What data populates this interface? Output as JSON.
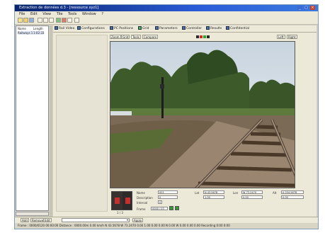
{
  "window": {
    "title": "Extraction de données d.3 - [ressource xyz1]",
    "min": "_",
    "max": "□",
    "close": "×"
  },
  "menu": [
    "File",
    "Edit",
    "View",
    "Tile",
    "Tools",
    "Window",
    "?"
  ],
  "left_panel": {
    "headers": [
      "Name",
      "Length"
    ],
    "rows": [
      [
        "Railways 1",
        "1:02:33"
      ]
    ]
  },
  "tabs": [
    "Rail Video",
    "Configurations",
    "PC Positions",
    "Grid",
    "Parameters",
    "Controller",
    "Results",
    "Confidential"
  ],
  "image_toolbar": {
    "buttons": [
      "Zoom",
      "Grid",
      "Tools",
      "Compare"
    ],
    "right_buttons": [
      "Left",
      "Right"
    ]
  },
  "thumbnail_caption": "1 / 3",
  "form": {
    "name_label": "Name",
    "name_value": "001",
    "description_label": "Description",
    "description_value": "0",
    "interval_label": "Interval",
    "interval_value": "0",
    "frame_label": "Frame",
    "frame_value": "0000 / 03",
    "col1_label": "Lat",
    "col1_value": "N 43.5678",
    "col1_sub": "1.00",
    "col2_label": "Lon",
    "col2_value": "W 73.2470",
    "col2_sub": "0.00",
    "col3_label": "Alt",
    "col3_value": "A 034.5678",
    "col3_sub": "0.00"
  },
  "bottom_bar": {
    "buttons": [
      "Add",
      "Remove",
      "Edit"
    ],
    "select_value": "",
    "right_button": "Apply"
  },
  "status_text": "Frame : 0000/0120  00:00:00  Distance : 0000.00m   0.00 km/h   N 43.5678   W 73.2470   0.00   1.00   0.00   0.00 N 0.00   W 0.00   0.00   0.00   Recording    0:00    0:00",
  "colors": {
    "title_bar": "#0a246a",
    "accent": "#2a5bd7",
    "close_button": "#c8402b"
  }
}
